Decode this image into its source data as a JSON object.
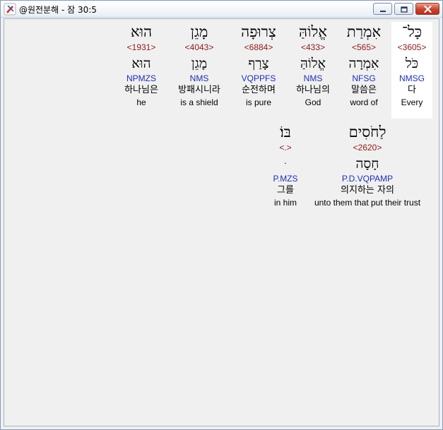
{
  "window": {
    "title": "@원전분해 - 잠 30:5"
  },
  "words": [
    {
      "hebrew": "כָּל־",
      "strong": "<3605>",
      "lemma": "כֹּל",
      "morph": "NMSG",
      "korean": "다",
      "english": "Every",
      "highlighted": true
    },
    {
      "hebrew": "אִמְרַת",
      "strong": "<565>",
      "lemma": "אִמְרָה",
      "morph": "NFSG",
      "korean": "말씀은",
      "english": "word of",
      "highlighted": false
    },
    {
      "hebrew": "אֱלוֹהַּ",
      "strong": "<433>",
      "lemma": "אֱלוֹהַּ",
      "morph": "NMS",
      "korean": "하나님의",
      "english": "God",
      "highlighted": false
    },
    {
      "hebrew": "צְרוּפָה",
      "strong": "<6884>",
      "lemma": "צָרַף",
      "morph": "VQPPFS",
      "korean": "순전하며",
      "english": "is pure",
      "highlighted": false
    },
    {
      "hebrew": "מָגֵן",
      "strong": "<4043>",
      "lemma": "מָגֵן",
      "morph": "NMS",
      "korean": "방패시니라",
      "english": "is a shield",
      "highlighted": false
    },
    {
      "hebrew": "הוּא",
      "strong": "<1931>",
      "lemma": "הוּא",
      "morph": "NPMZS",
      "korean": "하나님은",
      "english": "he",
      "highlighted": false
    },
    {
      "hebrew": "לַחֹסִים",
      "strong": "<2620>",
      "lemma": "חָסָה",
      "morph": "P.D.VQPAMP",
      "korean": "의지하는 자의",
      "english": "unto them that put their trust",
      "highlighted": false
    },
    {
      "hebrew": "בּוֹ׃",
      "strong": "<.>",
      "lemma": "ּ",
      "morph": "P.MZS",
      "korean": "그를",
      "english": "in him",
      "highlighted": false
    }
  ]
}
